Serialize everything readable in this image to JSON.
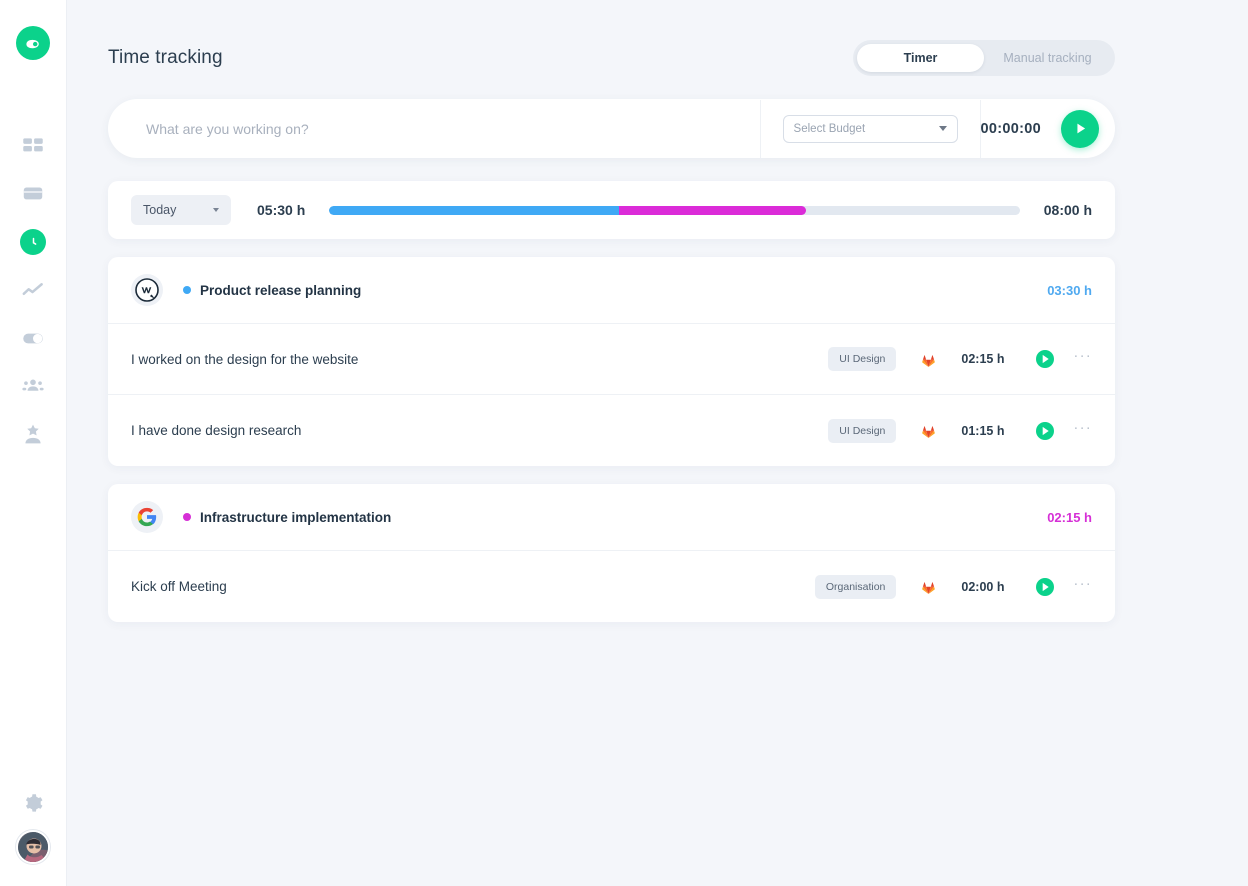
{
  "sidebar": {
    "brand": {
      "name": "app-logo",
      "color": "#0bd28b"
    },
    "items": [
      {
        "name": "dashboard",
        "icon": "grid-icon",
        "active": false
      },
      {
        "name": "projects",
        "icon": "wallet-icon",
        "active": false
      },
      {
        "name": "time-tracking",
        "icon": "clock-icon",
        "active": true
      },
      {
        "name": "reports",
        "icon": "chart-line-icon",
        "active": false
      },
      {
        "name": "toggle",
        "icon": "contrast-icon",
        "active": false
      },
      {
        "name": "team",
        "icon": "people-icon",
        "active": false
      },
      {
        "name": "clients",
        "icon": "star-user-icon",
        "active": false
      }
    ],
    "bottom": [
      {
        "name": "settings",
        "icon": "gear-icon"
      },
      {
        "name": "profile",
        "icon": "user-avatar"
      }
    ]
  },
  "header": {
    "title": "Time tracking",
    "tabs": [
      {
        "label": "Timer",
        "active": true
      },
      {
        "label": "Manual tracking",
        "active": false
      }
    ]
  },
  "timer": {
    "placeholder": "What are you working on?",
    "value": "",
    "budget_label": "Select Budget",
    "elapsed": "00:00:00",
    "play_label": "start-timer"
  },
  "summary": {
    "range_label": "Today",
    "tracked": "05:30 h",
    "goal": "08:00 h",
    "segments": [
      {
        "name": "Product release planning",
        "percent": 42,
        "color": "#3fa9f5"
      },
      {
        "name": "Infrastructure implementation",
        "percent": 27,
        "color": "#db2bd8"
      }
    ],
    "track_color": "#e2e8f0"
  },
  "projects": [
    {
      "avatar": "wordpress-logo",
      "dot_color": "#3fa9f5",
      "name": "Product release planning",
      "total": "03:30 h",
      "total_color": "#4fa9f0",
      "tasks": [
        {
          "title": "I worked on the design for the website",
          "tag": "UI Design",
          "source_icon": "gitlab-icon",
          "duration": "02:15 h"
        },
        {
          "title": "I have done design research",
          "tag": "UI Design",
          "source_icon": "gitlab-icon",
          "duration": "01:15 h"
        }
      ]
    },
    {
      "avatar": "google-logo",
      "dot_color": "#d62fd6",
      "name": "Infrastructure implementation",
      "total": "02:15 h",
      "total_color": "#d62fd6",
      "tasks": [
        {
          "title": "Kick off Meeting",
          "tag": "Organisation",
          "source_icon": "gitlab-icon",
          "duration": "02:00 h"
        }
      ]
    }
  ]
}
